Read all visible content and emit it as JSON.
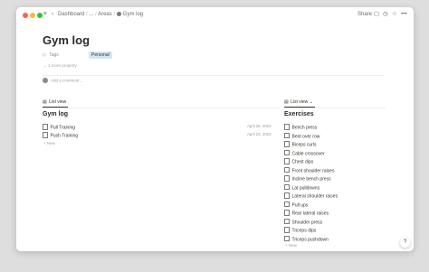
{
  "topbar": {
    "breadcrumb": [
      "Dashboard",
      "...",
      "Areas",
      "Gym log"
    ],
    "share_label": "Share",
    "icons": [
      "chevron-left-icon",
      "sidebar-toggle-icon",
      "comment-icon",
      "clock-icon",
      "star-icon",
      "more-icon"
    ]
  },
  "page": {
    "title": "Gym log",
    "props": {
      "tags_label": "Tags",
      "tag_value": "Personal",
      "more_properties": "1 more property"
    },
    "add_comment": "Add a comment..."
  },
  "left_view": {
    "tab_label": "List view",
    "title": "Gym log",
    "items": [
      {
        "name": "Pull Training",
        "date": "April 26, 2023"
      },
      {
        "name": "Push Training",
        "date": "April 23, 2023"
      }
    ],
    "new_label": "New"
  },
  "right_view": {
    "tab_label": "List view",
    "title": "Exercises",
    "items": [
      "Bench press",
      "Bent over row",
      "Biceps curls",
      "Cable crossover",
      "Chest dips",
      "Front shoulder raises",
      "Incline bench press",
      "Lat pulldowns",
      "Lateral shoulder raises",
      "Pull ups",
      "Rear lateral raises",
      "Shoulder press",
      "Triceps dips",
      "Triceps pushdown"
    ],
    "new_label": "New"
  },
  "help_label": "?"
}
